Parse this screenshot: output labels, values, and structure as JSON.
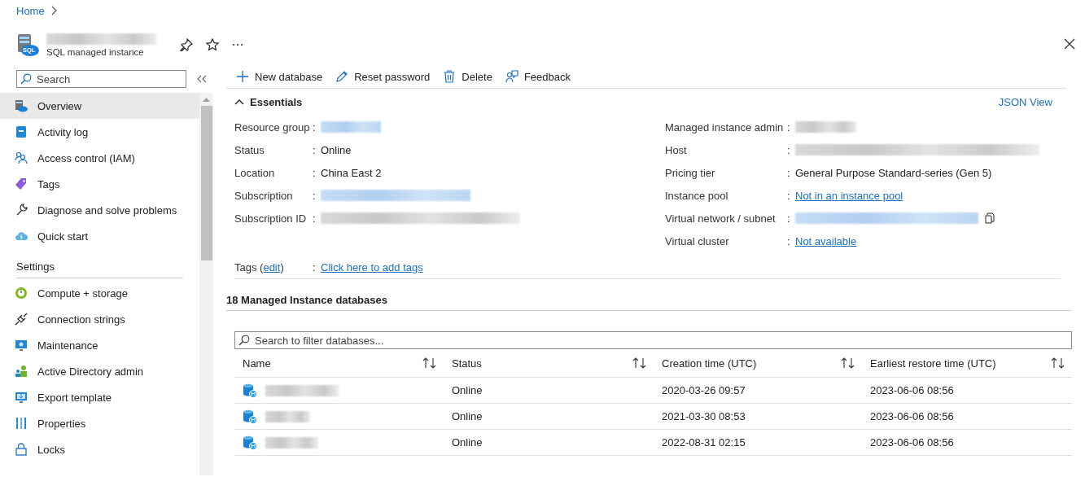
{
  "breadcrumb": [
    {
      "label": "Home"
    }
  ],
  "resource": {
    "icon_label": "SQL",
    "subtitle": "SQL managed instance"
  },
  "sidebar": {
    "search": {
      "placeholder": "Search"
    },
    "items": [
      {
        "label": "Overview",
        "selected": true
      },
      {
        "label": "Activity log",
        "selected": false
      },
      {
        "label": "Access control (IAM)",
        "selected": false
      },
      {
        "label": "Tags",
        "selected": false
      },
      {
        "label": "Diagnose and solve problems",
        "selected": false
      },
      {
        "label": "Quick start",
        "selected": false
      }
    ],
    "sections": [
      {
        "title": "Settings",
        "items": [
          {
            "label": "Compute + storage",
            "selected": false
          },
          {
            "label": "Connection strings",
            "selected": false
          },
          {
            "label": "Maintenance",
            "selected": false
          },
          {
            "label": "Active Directory admin",
            "selected": false
          },
          {
            "label": "Export template",
            "selected": false
          },
          {
            "label": "Properties",
            "selected": false
          },
          {
            "label": "Locks",
            "selected": false
          }
        ]
      }
    ]
  },
  "toolbar": [
    {
      "label": "New database"
    },
    {
      "label": "Reset password"
    },
    {
      "label": "Delete"
    },
    {
      "label": "Feedback"
    }
  ],
  "essentials": {
    "title": "Essentials",
    "expanded": true,
    "json_view": "JSON View",
    "left": [
      {
        "label": "Resource group",
        "colon": ":",
        "kind": "redacted"
      },
      {
        "label": "Status",
        "colon": ":",
        "kind": "text",
        "value": "Online"
      },
      {
        "label": "Location",
        "colon": ":",
        "kind": "text",
        "value": "China East 2"
      },
      {
        "label": "Subscription",
        "colon": ":",
        "kind": "redacted"
      },
      {
        "label": "Subscription ID",
        "colon": ":",
        "kind": "redacted"
      }
    ],
    "right": [
      {
        "label": "Managed instance admin",
        "colon": ":",
        "kind": "redacted"
      },
      {
        "label": "Host",
        "colon": ":",
        "kind": "redacted"
      },
      {
        "label": "Pricing tier",
        "colon": ":",
        "kind": "text",
        "value": "General Purpose Standard-series (Gen 5)"
      },
      {
        "label": "Instance pool",
        "colon": ":",
        "kind": "link",
        "value": "Not in an instance pool"
      },
      {
        "label": "Virtual network / subnet",
        "colon": ":",
        "kind": "redacted",
        "copy": true
      },
      {
        "label": "Virtual cluster",
        "colon": ":",
        "kind": "link",
        "value": "Not available"
      }
    ],
    "tags": {
      "prefix": "Tags (",
      "edit_link": "edit",
      "suffix": ")",
      "colon": ":",
      "value": "Click here to add tags"
    }
  },
  "databases": {
    "title": "18 Managed Instance databases",
    "search": {
      "placeholder": "Search to filter databases..."
    },
    "columns": [
      {
        "label": "Name"
      },
      {
        "label": "Status"
      },
      {
        "label": "Creation time (UTC)"
      },
      {
        "label": "Earliest restore time (UTC)"
      }
    ],
    "rows": [
      {
        "status": "Online",
        "created": "2020-03-26 09:57",
        "restore": "2023-06-06 08:56"
      },
      {
        "status": "Online",
        "created": "2021-03-30 08:53",
        "restore": "2023-06-06 08:56"
      },
      {
        "status": "Online",
        "created": "2022-08-31 02:15",
        "restore": "2023-06-06 08:56"
      }
    ]
  }
}
